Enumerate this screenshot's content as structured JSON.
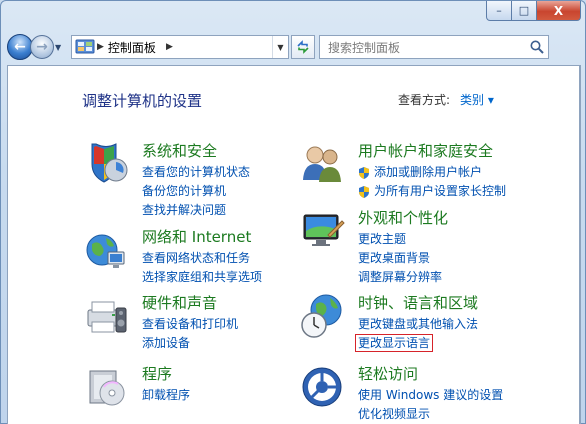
{
  "window": {
    "caption": {
      "minimize": "–",
      "maximize": "□",
      "close": "X"
    }
  },
  "nav": {
    "address_label": "控制面板",
    "search_placeholder": "搜索控制面板"
  },
  "header": {
    "title": "调整计算机的设置",
    "view_by_label": "查看方式:",
    "view_by_value": "类别 ▾"
  },
  "categories": [
    {
      "title": "系统和安全",
      "icon": "shield-check-icon",
      "links": [
        "查看您的计算机状态",
        "备份您的计算机",
        "查找并解决问题"
      ]
    },
    {
      "title": "网络和 Internet",
      "icon": "network-globe-icon",
      "links": [
        "查看网络状态和任务",
        "选择家庭组和共享选项"
      ]
    },
    {
      "title": "硬件和声音",
      "icon": "printer-icon",
      "links": [
        "查看设备和打印机",
        "添加设备"
      ]
    },
    {
      "title": "程序",
      "icon": "programs-icon",
      "links": [
        "卸载程序"
      ]
    },
    {
      "title": "用户帐户和家庭安全",
      "icon": "users-icon",
      "links": [
        "添加或删除用户帐户",
        "为所有用户设置家长控制"
      ]
    },
    {
      "title": "外观和个性化",
      "icon": "appearance-icon",
      "links": [
        "更改主题",
        "更改桌面背景",
        "调整屏幕分辨率"
      ]
    },
    {
      "title": "时钟、语言和区域",
      "icon": "clock-globe-icon",
      "links": [
        "更改键盘或其他输入法",
        "更改显示语言"
      ]
    },
    {
      "title": "轻松访问",
      "icon": "ease-of-access-icon",
      "links": [
        "使用 Windows 建议的设置",
        "优化视频显示"
      ]
    }
  ],
  "colors": {
    "heading": "#1e3287",
    "category_title": "#1c7a20",
    "link": "#0050b0",
    "highlight_box": "#d6232a"
  }
}
